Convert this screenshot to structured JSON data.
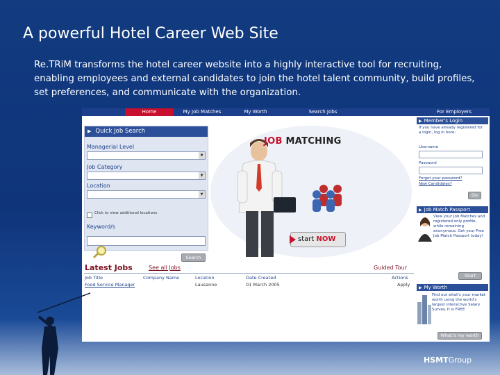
{
  "slide": {
    "title": "A powerful Hotel Career Web Site",
    "body": "Re.TRiM transforms the hotel career website into a highly interactive tool for recruiting, enabling employees and external candidates to join the hotel talent community, build profiles, set preferences, and communicate with the organization."
  },
  "nav": {
    "home": "Home",
    "my_job_matches": "My Job Matches",
    "my_worth": "My Worth",
    "search_jobs": "Search Jobs",
    "for_employers": "For Employers"
  },
  "quick_search": {
    "title": "Quick Job Search",
    "label_level": "Managerial Level",
    "label_category": "Job Category",
    "label_location": "Location",
    "checkbox_label": "Click to view additional locations",
    "label_keywords": "Keyword/s",
    "search_button": "Search"
  },
  "hero": {
    "heading_red": "JOB",
    "heading_dark": "MATCHING",
    "start_label": "start",
    "start_now": "NOW"
  },
  "members_login": {
    "title": "Member's Login",
    "intro": "If you have already registered for a login, log in here:",
    "username_label": "Username",
    "password_label": "Password",
    "forgot": "Forgot your password?",
    "new_candidates": "New Candidates?",
    "go_button": "Go"
  },
  "job_passport": {
    "title": "Job Match Passport",
    "text": "View your Job Matches and registered only profile, while remaining anonymous. Get your Free Job Match Passport today!",
    "button": "Start Now"
  },
  "my_worth": {
    "title": "My Worth",
    "text": "Find out what's your market worth using the world's largest interactive Salary Survey. It is FREE",
    "button": "What's my worth"
  },
  "latest_jobs": {
    "title": "Latest Jobs",
    "see_all": "See all Jobs",
    "guided_tour": "Guided Tour",
    "columns": [
      "Job Title",
      "Company Name",
      "Location",
      "Date Created",
      "Actions"
    ],
    "rows": [
      [
        "Food Service Manager",
        "",
        "Lausanne",
        "01 March 2005",
        "Apply"
      ]
    ]
  },
  "footer": {
    "logo_a": "HSMT",
    "logo_b": "Group"
  }
}
